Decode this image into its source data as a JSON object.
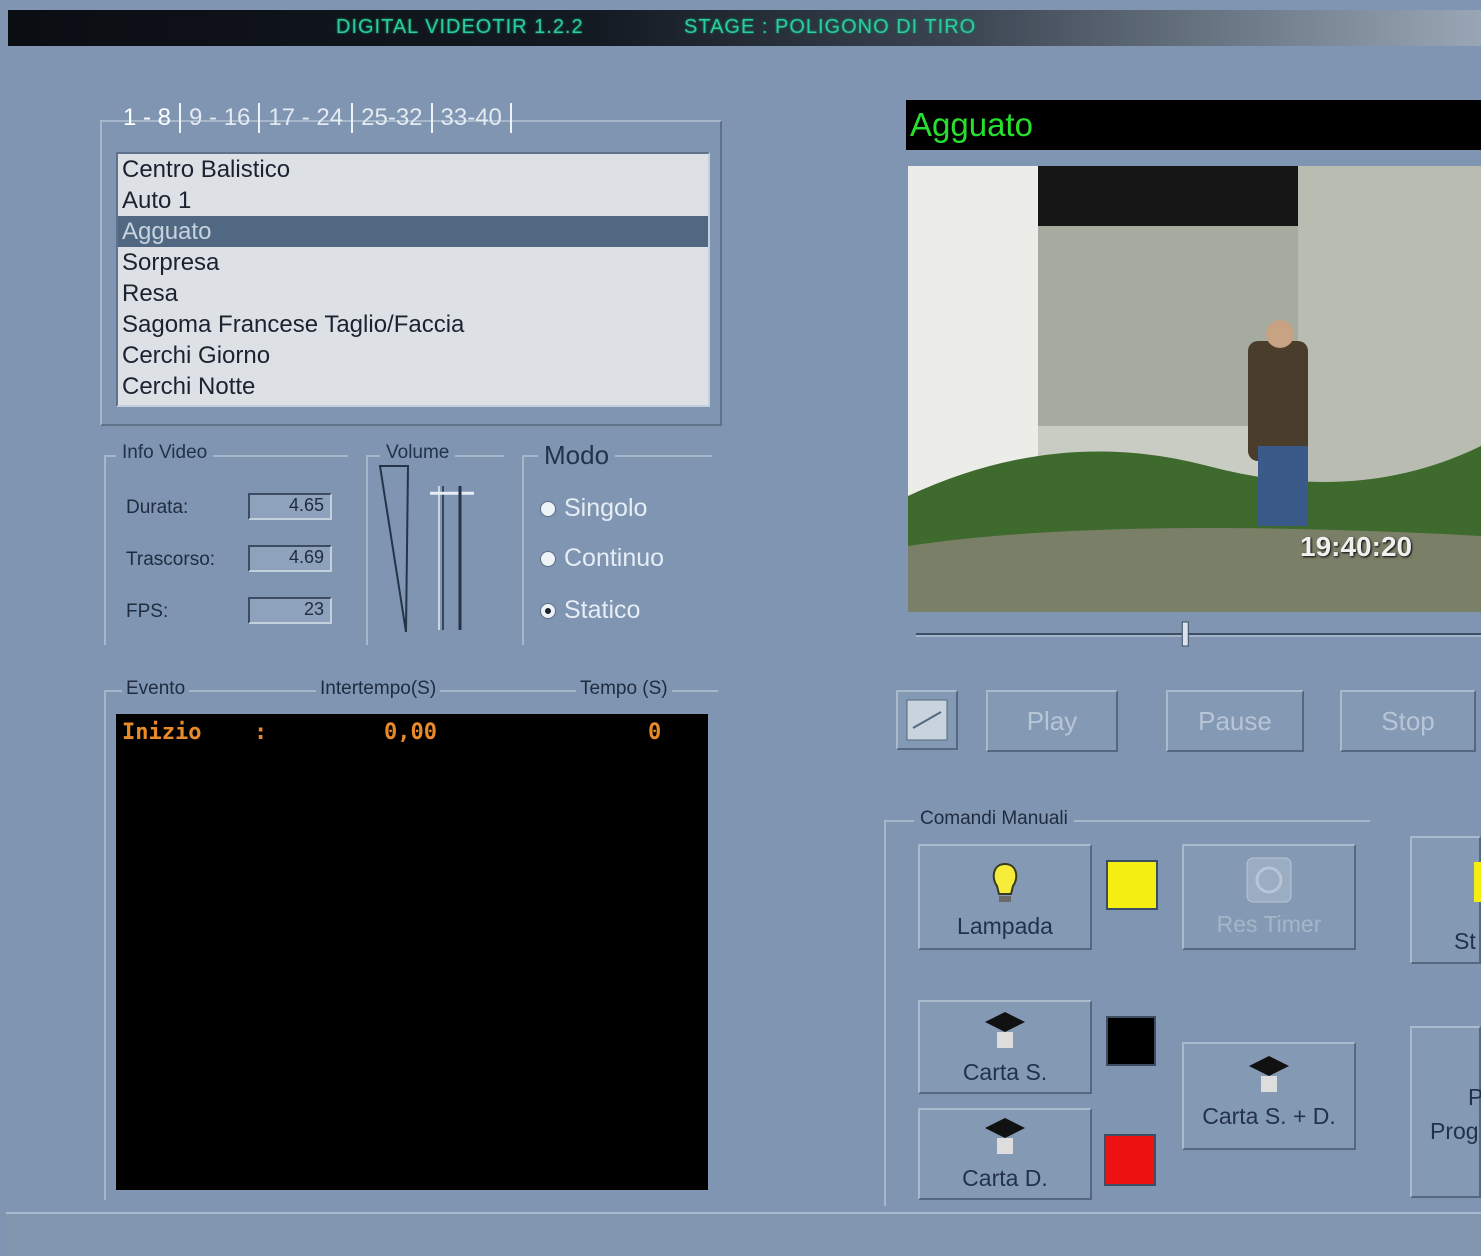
{
  "window": {
    "title_left": "DIGITAL VIDEOTIR 1.2.2",
    "title_right": "STAGE : POLIGONO DI TIRO"
  },
  "tabs": [
    "1 - 8",
    "9 - 16",
    "17 - 24",
    "25-32",
    "33-40"
  ],
  "scenario_list": {
    "items": [
      "Centro Balistico",
      "Auto 1",
      "Agguato",
      "Sorpresa",
      "Resa",
      "Sagoma Francese Taglio/Faccia",
      "Cerchi Giorno",
      "Cerchi Notte"
    ],
    "selected": "Agguato"
  },
  "info_video": {
    "title": "Info Video",
    "durata_label": "Durata:",
    "durata_value": "4.65",
    "trascorso_label": "Trascorso:",
    "trascorso_value": "4.69",
    "fps_label": "FPS:",
    "fps_value": "23"
  },
  "volume": {
    "title": "Volume",
    "level": 0.95
  },
  "modo": {
    "title": "Modo",
    "options": [
      "Singolo",
      "Continuo",
      "Statico"
    ],
    "selected": "Statico"
  },
  "events": {
    "headers": [
      "Evento",
      "Intertempo(S)",
      "Tempo (S)"
    ],
    "rows": [
      {
        "evento": "Inizio",
        "sep": ":",
        "intertempo": "0,00",
        "tempo": "0"
      }
    ]
  },
  "video": {
    "title": "Agguato",
    "timestamp": "19:40:20",
    "progress": 0.48
  },
  "transport": {
    "play": "Play",
    "pause": "Pause",
    "stop": "Stop"
  },
  "manual": {
    "title": "Comandi Manuali",
    "lampada": "Lampada",
    "reset_timer": "Res Timer",
    "carta_s": "Carta S.",
    "carta_d": "Carta D.",
    "carta_sd": "Carta S. + D.",
    "st_partial": "St",
    "prog_partial": "Prog",
    "p_partial": "P"
  },
  "colors": {
    "lampada_swatch": "#f4ee12",
    "carta_s_swatch": "#000000",
    "carta_d_swatch": "#ee1111",
    "accent_green": "#27e02e",
    "event_text": "#e88a2a"
  }
}
